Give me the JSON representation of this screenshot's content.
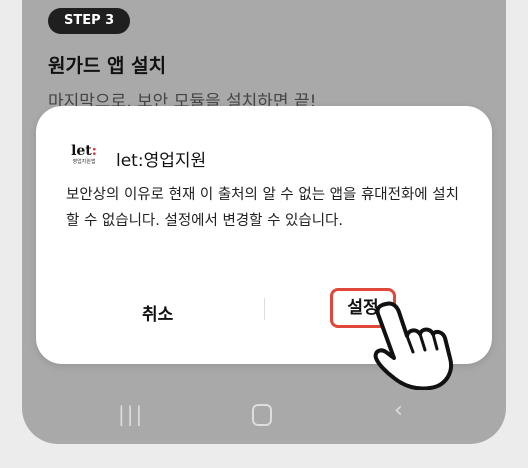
{
  "background_step": {
    "badge": "STEP 3",
    "title": "원가드 앱 설치",
    "description": "마지막으로, 보안 모듈을 설치하면 끝!"
  },
  "dialog": {
    "app_logo": {
      "main_prefix": "let",
      "main_accent": ":",
      "sub": "영업지원앱"
    },
    "app_name": "let:영업지원",
    "message": "보안상의 이유로 현재 이 출처의 알 수 없는 앱을 휴대전화에 설치할 수 없습니다. 설정에서 변경할 수 있습니다.",
    "cancel_label": "취소",
    "settings_label": "설정"
  },
  "nav": {
    "recent_icon": "recent-apps-icon",
    "home_icon": "home-icon",
    "back_icon": "back-icon"
  },
  "colors": {
    "dim_overlay": "#a9a9a9",
    "highlight": "#e0493a",
    "logo_accent": "#e0262a"
  }
}
